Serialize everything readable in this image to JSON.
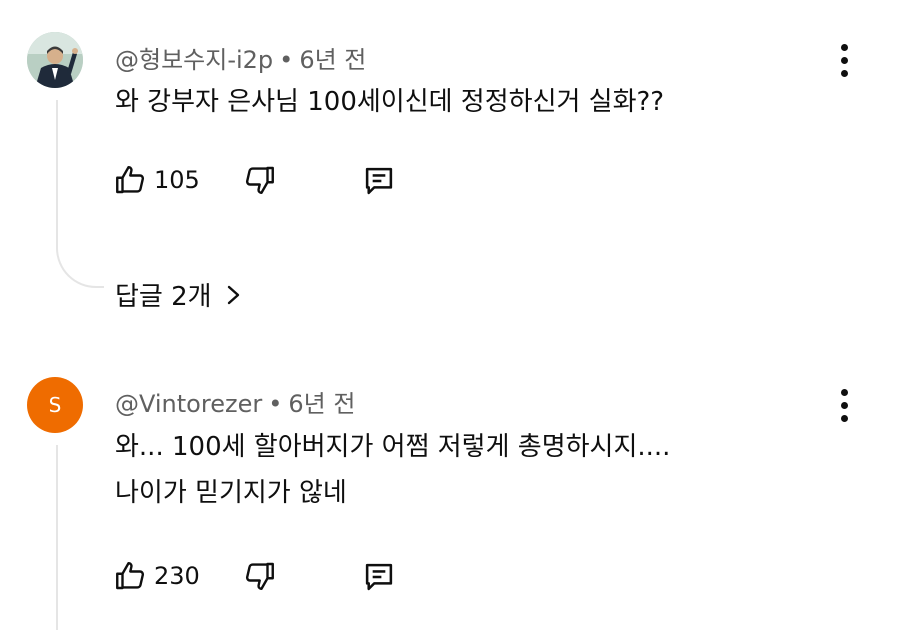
{
  "comments": [
    {
      "author": "@형보수지-i2p",
      "time": "6년 전",
      "text_lines": [
        "와 강부자 은사님 100세이신데 정정하신거 실화??"
      ],
      "likes": "105",
      "replies_label": "답글 2개"
    },
    {
      "author": "@Vintorezer",
      "avatar_letter": "S",
      "time": "6년 전",
      "text_lines": [
        "와... 100세 할아버지가 어쩜 저렇게 총명하시지....",
        "나이가 믿기지가 않네"
      ],
      "likes": "230"
    }
  ],
  "colors": {
    "avatar_orange": "#ef6c00",
    "meta_gray": "#606060",
    "thread_line": "#e5e5e5"
  },
  "icons": [
    "thumb-up-icon",
    "thumb-down-icon",
    "reply-icon",
    "more-vert-icon",
    "chevron-right-icon"
  ]
}
